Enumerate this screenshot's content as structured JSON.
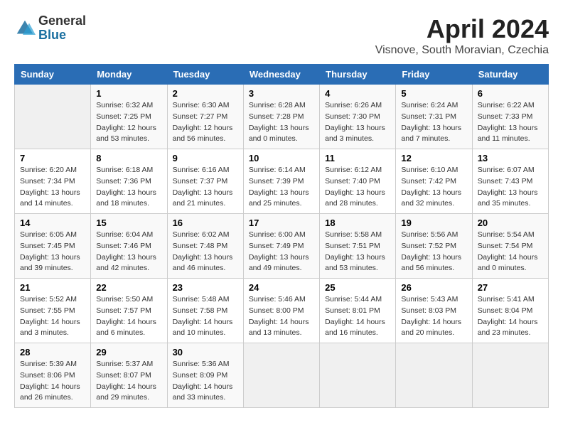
{
  "header": {
    "logo_general": "General",
    "logo_blue": "Blue",
    "month_title": "April 2024",
    "location": "Visnove, South Moravian, Czechia"
  },
  "calendar": {
    "days_of_week": [
      "Sunday",
      "Monday",
      "Tuesday",
      "Wednesday",
      "Thursday",
      "Friday",
      "Saturday"
    ],
    "weeks": [
      [
        {
          "day": "",
          "info": ""
        },
        {
          "day": "1",
          "info": "Sunrise: 6:32 AM\nSunset: 7:25 PM\nDaylight: 12 hours\nand 53 minutes."
        },
        {
          "day": "2",
          "info": "Sunrise: 6:30 AM\nSunset: 7:27 PM\nDaylight: 12 hours\nand 56 minutes."
        },
        {
          "day": "3",
          "info": "Sunrise: 6:28 AM\nSunset: 7:28 PM\nDaylight: 13 hours\nand 0 minutes."
        },
        {
          "day": "4",
          "info": "Sunrise: 6:26 AM\nSunset: 7:30 PM\nDaylight: 13 hours\nand 3 minutes."
        },
        {
          "day": "5",
          "info": "Sunrise: 6:24 AM\nSunset: 7:31 PM\nDaylight: 13 hours\nand 7 minutes."
        },
        {
          "day": "6",
          "info": "Sunrise: 6:22 AM\nSunset: 7:33 PM\nDaylight: 13 hours\nand 11 minutes."
        }
      ],
      [
        {
          "day": "7",
          "info": "Sunrise: 6:20 AM\nSunset: 7:34 PM\nDaylight: 13 hours\nand 14 minutes."
        },
        {
          "day": "8",
          "info": "Sunrise: 6:18 AM\nSunset: 7:36 PM\nDaylight: 13 hours\nand 18 minutes."
        },
        {
          "day": "9",
          "info": "Sunrise: 6:16 AM\nSunset: 7:37 PM\nDaylight: 13 hours\nand 21 minutes."
        },
        {
          "day": "10",
          "info": "Sunrise: 6:14 AM\nSunset: 7:39 PM\nDaylight: 13 hours\nand 25 minutes."
        },
        {
          "day": "11",
          "info": "Sunrise: 6:12 AM\nSunset: 7:40 PM\nDaylight: 13 hours\nand 28 minutes."
        },
        {
          "day": "12",
          "info": "Sunrise: 6:10 AM\nSunset: 7:42 PM\nDaylight: 13 hours\nand 32 minutes."
        },
        {
          "day": "13",
          "info": "Sunrise: 6:07 AM\nSunset: 7:43 PM\nDaylight: 13 hours\nand 35 minutes."
        }
      ],
      [
        {
          "day": "14",
          "info": "Sunrise: 6:05 AM\nSunset: 7:45 PM\nDaylight: 13 hours\nand 39 minutes."
        },
        {
          "day": "15",
          "info": "Sunrise: 6:04 AM\nSunset: 7:46 PM\nDaylight: 13 hours\nand 42 minutes."
        },
        {
          "day": "16",
          "info": "Sunrise: 6:02 AM\nSunset: 7:48 PM\nDaylight: 13 hours\nand 46 minutes."
        },
        {
          "day": "17",
          "info": "Sunrise: 6:00 AM\nSunset: 7:49 PM\nDaylight: 13 hours\nand 49 minutes."
        },
        {
          "day": "18",
          "info": "Sunrise: 5:58 AM\nSunset: 7:51 PM\nDaylight: 13 hours\nand 53 minutes."
        },
        {
          "day": "19",
          "info": "Sunrise: 5:56 AM\nSunset: 7:52 PM\nDaylight: 13 hours\nand 56 minutes."
        },
        {
          "day": "20",
          "info": "Sunrise: 5:54 AM\nSunset: 7:54 PM\nDaylight: 14 hours\nand 0 minutes."
        }
      ],
      [
        {
          "day": "21",
          "info": "Sunrise: 5:52 AM\nSunset: 7:55 PM\nDaylight: 14 hours\nand 3 minutes."
        },
        {
          "day": "22",
          "info": "Sunrise: 5:50 AM\nSunset: 7:57 PM\nDaylight: 14 hours\nand 6 minutes."
        },
        {
          "day": "23",
          "info": "Sunrise: 5:48 AM\nSunset: 7:58 PM\nDaylight: 14 hours\nand 10 minutes."
        },
        {
          "day": "24",
          "info": "Sunrise: 5:46 AM\nSunset: 8:00 PM\nDaylight: 14 hours\nand 13 minutes."
        },
        {
          "day": "25",
          "info": "Sunrise: 5:44 AM\nSunset: 8:01 PM\nDaylight: 14 hours\nand 16 minutes."
        },
        {
          "day": "26",
          "info": "Sunrise: 5:43 AM\nSunset: 8:03 PM\nDaylight: 14 hours\nand 20 minutes."
        },
        {
          "day": "27",
          "info": "Sunrise: 5:41 AM\nSunset: 8:04 PM\nDaylight: 14 hours\nand 23 minutes."
        }
      ],
      [
        {
          "day": "28",
          "info": "Sunrise: 5:39 AM\nSunset: 8:06 PM\nDaylight: 14 hours\nand 26 minutes."
        },
        {
          "day": "29",
          "info": "Sunrise: 5:37 AM\nSunset: 8:07 PM\nDaylight: 14 hours\nand 29 minutes."
        },
        {
          "day": "30",
          "info": "Sunrise: 5:36 AM\nSunset: 8:09 PM\nDaylight: 14 hours\nand 33 minutes."
        },
        {
          "day": "",
          "info": ""
        },
        {
          "day": "",
          "info": ""
        },
        {
          "day": "",
          "info": ""
        },
        {
          "day": "",
          "info": ""
        }
      ]
    ]
  }
}
